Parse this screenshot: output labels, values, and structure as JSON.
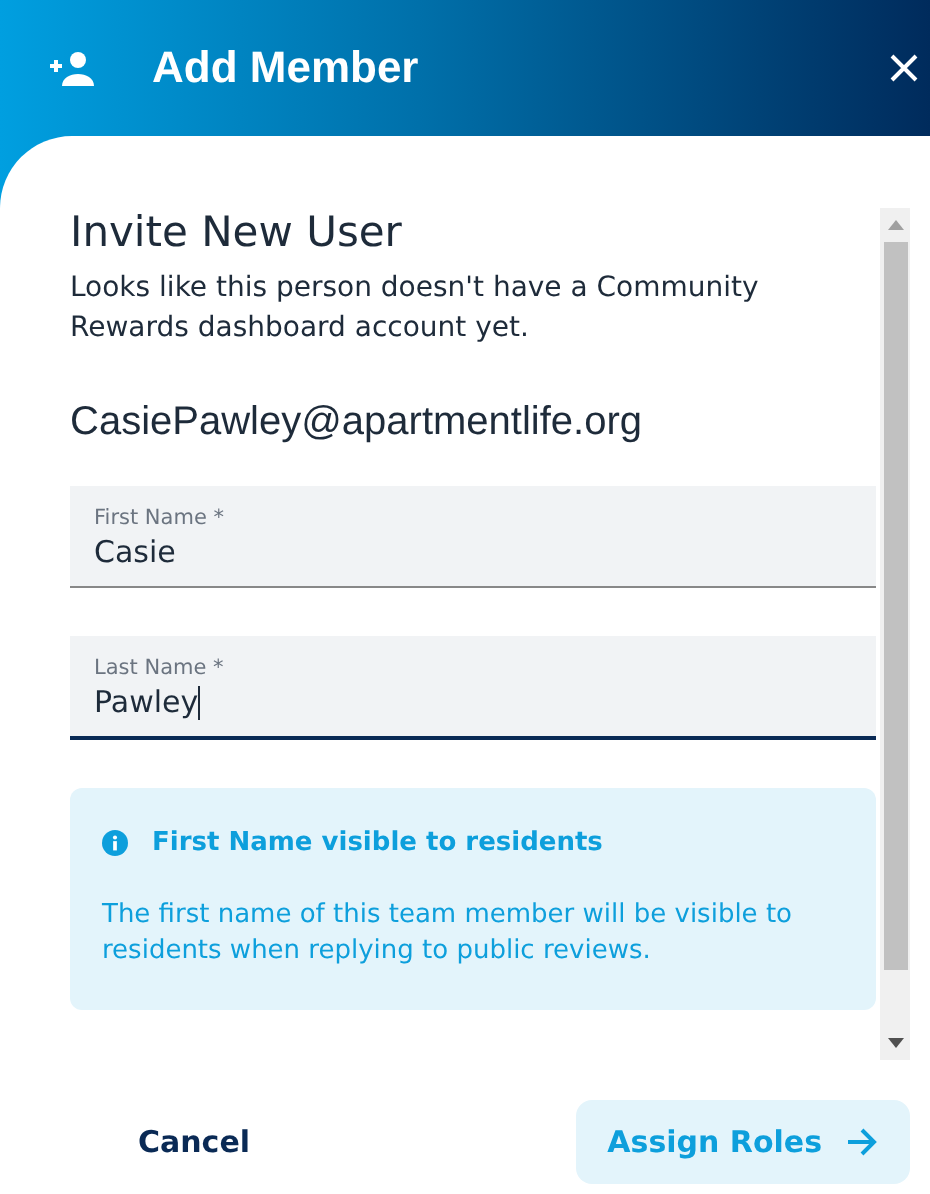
{
  "dialog": {
    "title": "Add Member"
  },
  "section": {
    "title": "Invite New User",
    "description": "Looks like this person doesn't have a Community Rewards dashboard account yet.",
    "email": "CasiePawley@apartmentlife.org"
  },
  "fields": [
    {
      "label": "First Name *",
      "value": "Casie",
      "focused": false
    },
    {
      "label": "Last Name *",
      "value": "Pawley",
      "focused": true
    }
  ],
  "notice": {
    "title": "First Name visible to residents",
    "body": "The first name of this team member will be visible to residents when replying to public reviews."
  },
  "buttons": [
    {
      "label": "Cancel",
      "kind": "text"
    },
    {
      "label": "Assign Roles",
      "kind": "primary"
    }
  ]
}
